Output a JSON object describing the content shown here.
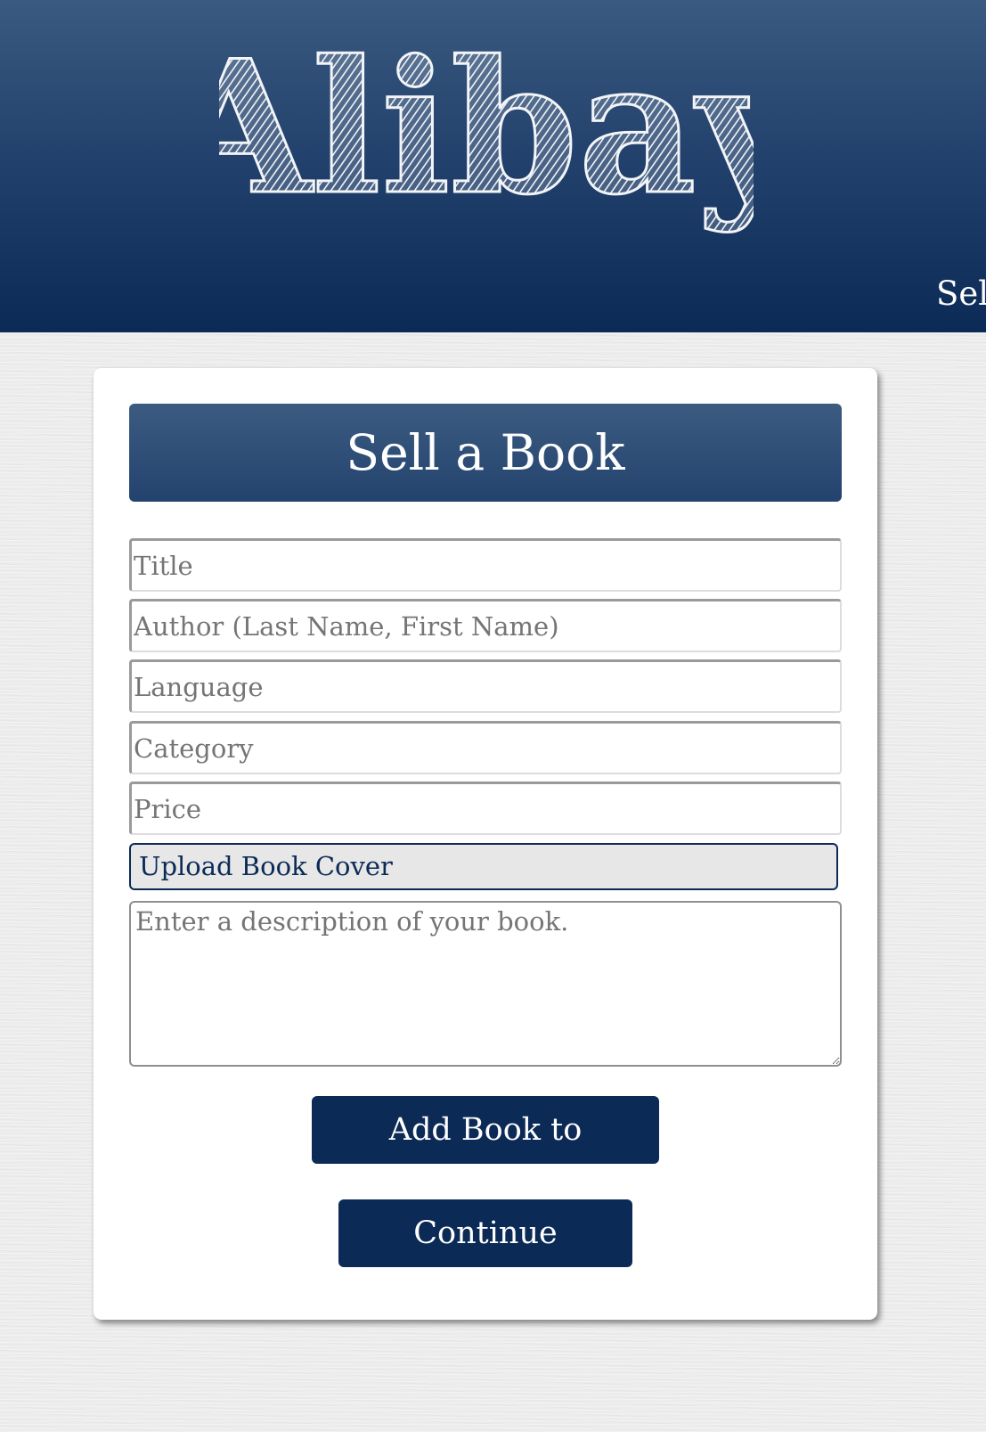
{
  "header": {
    "logo_text": "Alibay",
    "nav_sell_label": "Sell"
  },
  "form": {
    "title": "Sell a Book",
    "fields": {
      "title_placeholder": "Title",
      "author_placeholder": "Author (Last Name, First Name)",
      "language_placeholder": "Language",
      "category_placeholder": "Category",
      "price_placeholder": "Price"
    },
    "upload_label": "Upload Book Cover",
    "description_placeholder": "Enter a description of your book.",
    "add_button_label": "Add Book to Inventory",
    "continue_button_label": "Continue Shopping"
  },
  "colors": {
    "brand_navy": "#0b2a56",
    "header_top": "#3b5a80",
    "page_background": "#ececec",
    "upload_background": "#e7e7e7"
  }
}
